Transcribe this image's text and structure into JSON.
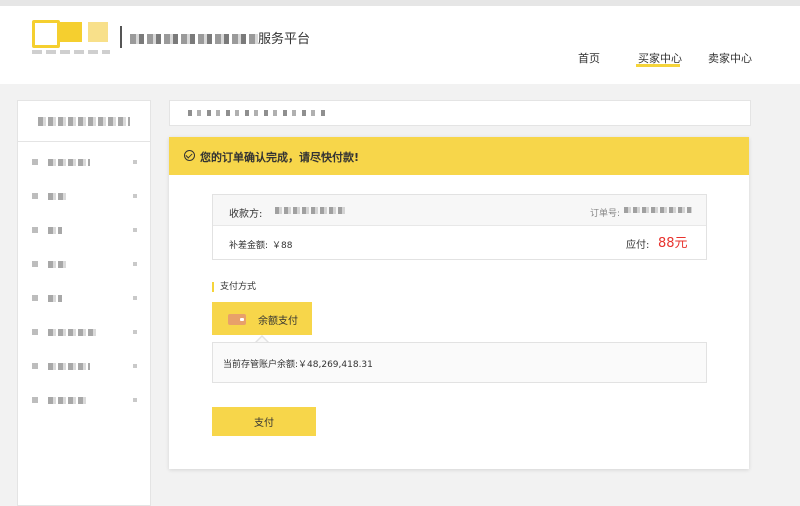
{
  "header": {
    "platform_suffix": "服务平台",
    "nav": [
      {
        "label": "首页",
        "active": false
      },
      {
        "label": "买家中心",
        "active": true
      },
      {
        "label": "卖家中心",
        "active": false
      }
    ]
  },
  "notice": {
    "text": "您的订单确认完成，请尽快付款!"
  },
  "order": {
    "payee_label": "收款方:",
    "order_no_label": "订单号:",
    "diff_label": "补差金额:",
    "diff_value": "￥88",
    "due_label": "应付:",
    "due_amount": "88元"
  },
  "payment": {
    "section_title": "支付方式",
    "method_label": "余额支付",
    "balance_text": "当前存管账户余额:￥48,269,418.31",
    "pay_button": "支付"
  },
  "colors": {
    "accent": "#f7d64a",
    "amount_red": "#e8332e"
  },
  "icons": [
    "check-circle-icon",
    "wallet-icon"
  ]
}
